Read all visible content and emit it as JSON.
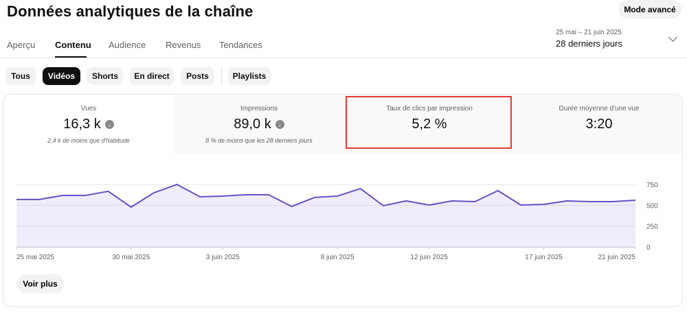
{
  "header": {
    "title": "Données analytiques de la chaîne",
    "advanced_mode": "Mode avancé"
  },
  "tabs": [
    "Aperçu",
    "Contenu",
    "Audience",
    "Revenus",
    "Tendances"
  ],
  "date": {
    "range": "25 mai – 21 juin 2025",
    "label": "28 derniers jours"
  },
  "chips": [
    "Tous",
    "Vidéos",
    "Shorts",
    "En direct",
    "Posts",
    "Playlists"
  ],
  "metrics": [
    {
      "label": "Vues",
      "value": "16,3 k",
      "sub": "2,4 k de moins que d'habitude",
      "trend": "down"
    },
    {
      "label": "Impressions",
      "value": "89,0 k",
      "sub": "8 % de moins que les 28 derniers jours",
      "trend": "down"
    },
    {
      "label": "Taux de clics par impression",
      "value": "5,2 %"
    },
    {
      "label": "Durée moyenne d'une vue",
      "value": "3:20"
    }
  ],
  "see_more": "Voir plus",
  "colors": {
    "line": "#6750c4",
    "fill": "#ede9fa",
    "highlight": "#e53935"
  },
  "chart_data": {
    "type": "area",
    "title": "Vues",
    "x": [
      "25 mai",
      "26 mai",
      "27 mai",
      "28 mai",
      "29 mai",
      "30 mai",
      "31 mai",
      "1 juin",
      "2 juin",
      "3 juin",
      "4 juin",
      "5 juin",
      "6 juin",
      "7 juin",
      "8 juin",
      "9 juin",
      "10 juin",
      "11 juin",
      "12 juin",
      "13 juin",
      "14 juin",
      "15 juin",
      "16 juin",
      "17 juin",
      "18 juin",
      "19 juin",
      "20 juin",
      "21 juin"
    ],
    "values": [
      570,
      570,
      618,
      618,
      668,
      478,
      651,
      750,
      602,
      610,
      626,
      626,
      486,
      594,
      610,
      700,
      495,
      552,
      503,
      552,
      544,
      676,
      503,
      511,
      552,
      544,
      544,
      560
    ],
    "xticks": [
      {
        "i": 0,
        "label": "25 mai 2025"
      },
      {
        "i": 5,
        "label": "30 mai 2025"
      },
      {
        "i": 9,
        "label": "3 juin 2025"
      },
      {
        "i": 14,
        "label": "8 juin 2025"
      },
      {
        "i": 18,
        "label": "12 juin 2025"
      },
      {
        "i": 23,
        "label": "17 juin 2025"
      },
      {
        "i": 27,
        "label": "21 juin 2025"
      }
    ],
    "yticks": [
      0,
      250,
      500,
      750
    ],
    "ylim": [
      0,
      750
    ],
    "grid": true
  }
}
